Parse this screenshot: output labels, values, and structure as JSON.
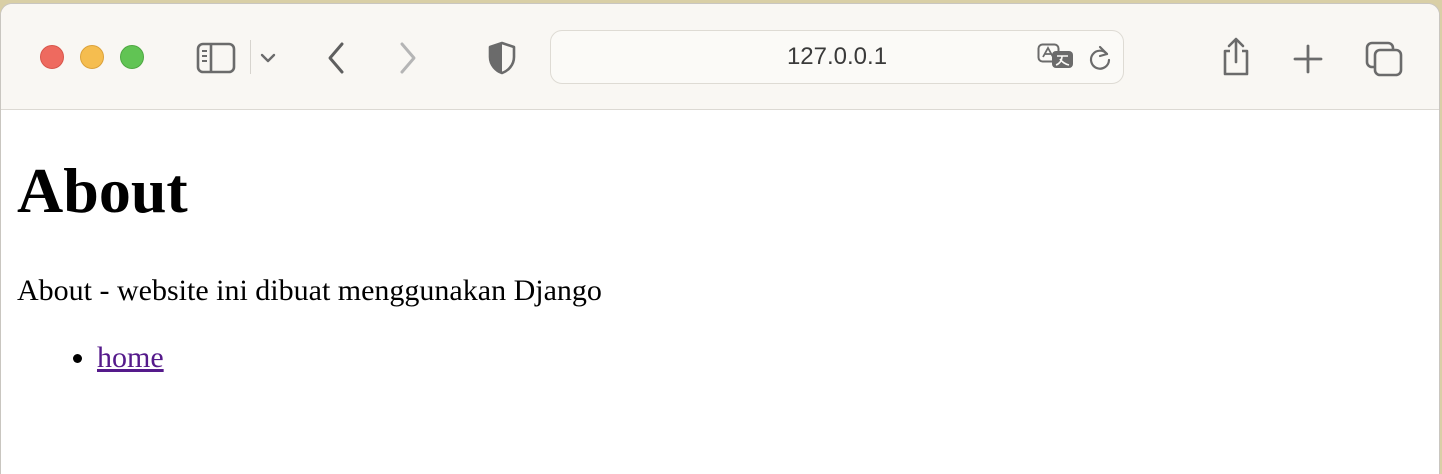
{
  "browser": {
    "address_bar": {
      "url": "127.0.0.1"
    },
    "icons": {
      "sidebar": "sidebar-icon",
      "dropdown": "chevron-down-icon",
      "back": "chevron-left-icon",
      "forward": "chevron-right-icon",
      "privacy": "shield-icon",
      "translate": "translate-icon",
      "reload": "reload-icon",
      "share": "share-icon",
      "new_tab": "plus-icon",
      "tabs": "tabs-overview-icon"
    },
    "colors": {
      "close": "#ee6a5f",
      "minimize": "#f5bd4f",
      "maximize": "#61c454"
    }
  },
  "page": {
    "heading": "About",
    "description": "About - website ini dibuat menggunakan Django",
    "links": [
      {
        "label": "home"
      }
    ]
  }
}
